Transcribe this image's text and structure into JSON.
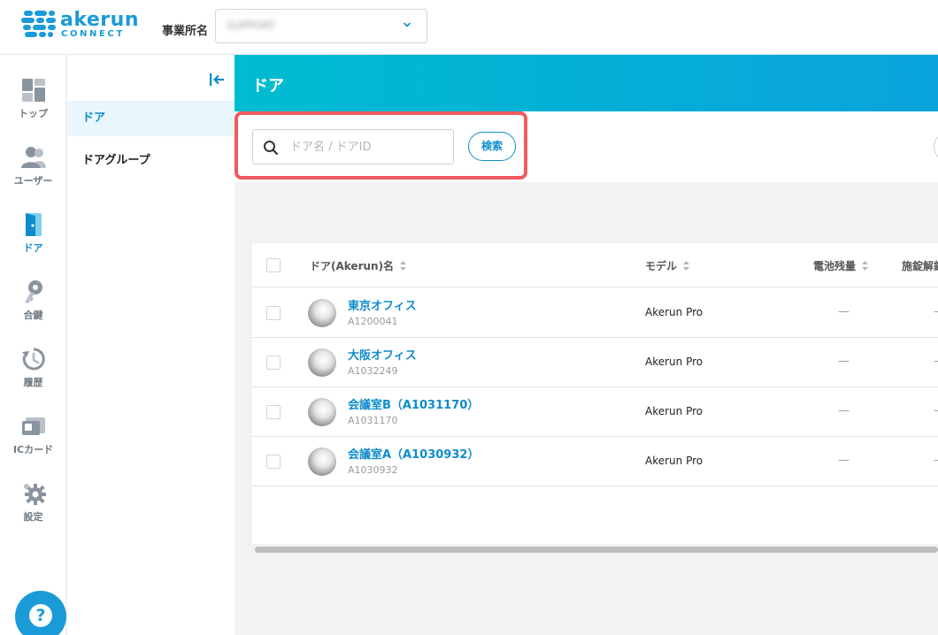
{
  "brand": {
    "name": "akerun",
    "sub": "CONNECT",
    "color": "#1a9bd8"
  },
  "header": {
    "office_label": "事業所名",
    "office_value": "SUPPORT"
  },
  "rail": {
    "items": [
      {
        "label": "トップ",
        "icon": "dashboard-icon"
      },
      {
        "label": "ユーザー",
        "icon": "users-icon"
      },
      {
        "label": "ドア",
        "icon": "door-icon",
        "active": true
      },
      {
        "label": "合鍵",
        "icon": "key-icon"
      },
      {
        "label": "履歴",
        "icon": "history-icon"
      },
      {
        "label": "ICカード",
        "icon": "ic-card-icon"
      },
      {
        "label": "設定",
        "icon": "gear-icon"
      }
    ],
    "help_label": "?"
  },
  "subnav": {
    "items": [
      {
        "label": "ドア",
        "active": true
      },
      {
        "label": "ドアグループ"
      }
    ]
  },
  "page": {
    "title": "ドア",
    "accent": "#00bcd0"
  },
  "search": {
    "placeholder": "ドア名 / ドアID",
    "value": "",
    "button_label": "検索"
  },
  "table": {
    "columns": [
      "ドア(Akerun)名",
      "モデル",
      "電池残量",
      "施錠解錠"
    ],
    "rows": [
      {
        "name": "東京オフィス",
        "id": "A1200041",
        "model": "Akerun Pro",
        "battery": "—",
        "lock": "—"
      },
      {
        "name": "大阪オフィス",
        "id": "A1032249",
        "model": "Akerun Pro",
        "battery": "—",
        "lock": "—"
      },
      {
        "name": "会議室B（A1031170）",
        "id": "A1031170",
        "model": "Akerun Pro",
        "battery": "—",
        "lock": "—"
      },
      {
        "name": "会議室A（A1030932）",
        "id": "A1030932",
        "model": "Akerun Pro",
        "battery": "—",
        "lock": "—"
      }
    ]
  },
  "colors": {
    "link": "#0e8ccb",
    "highlight": "#f05a5e"
  }
}
